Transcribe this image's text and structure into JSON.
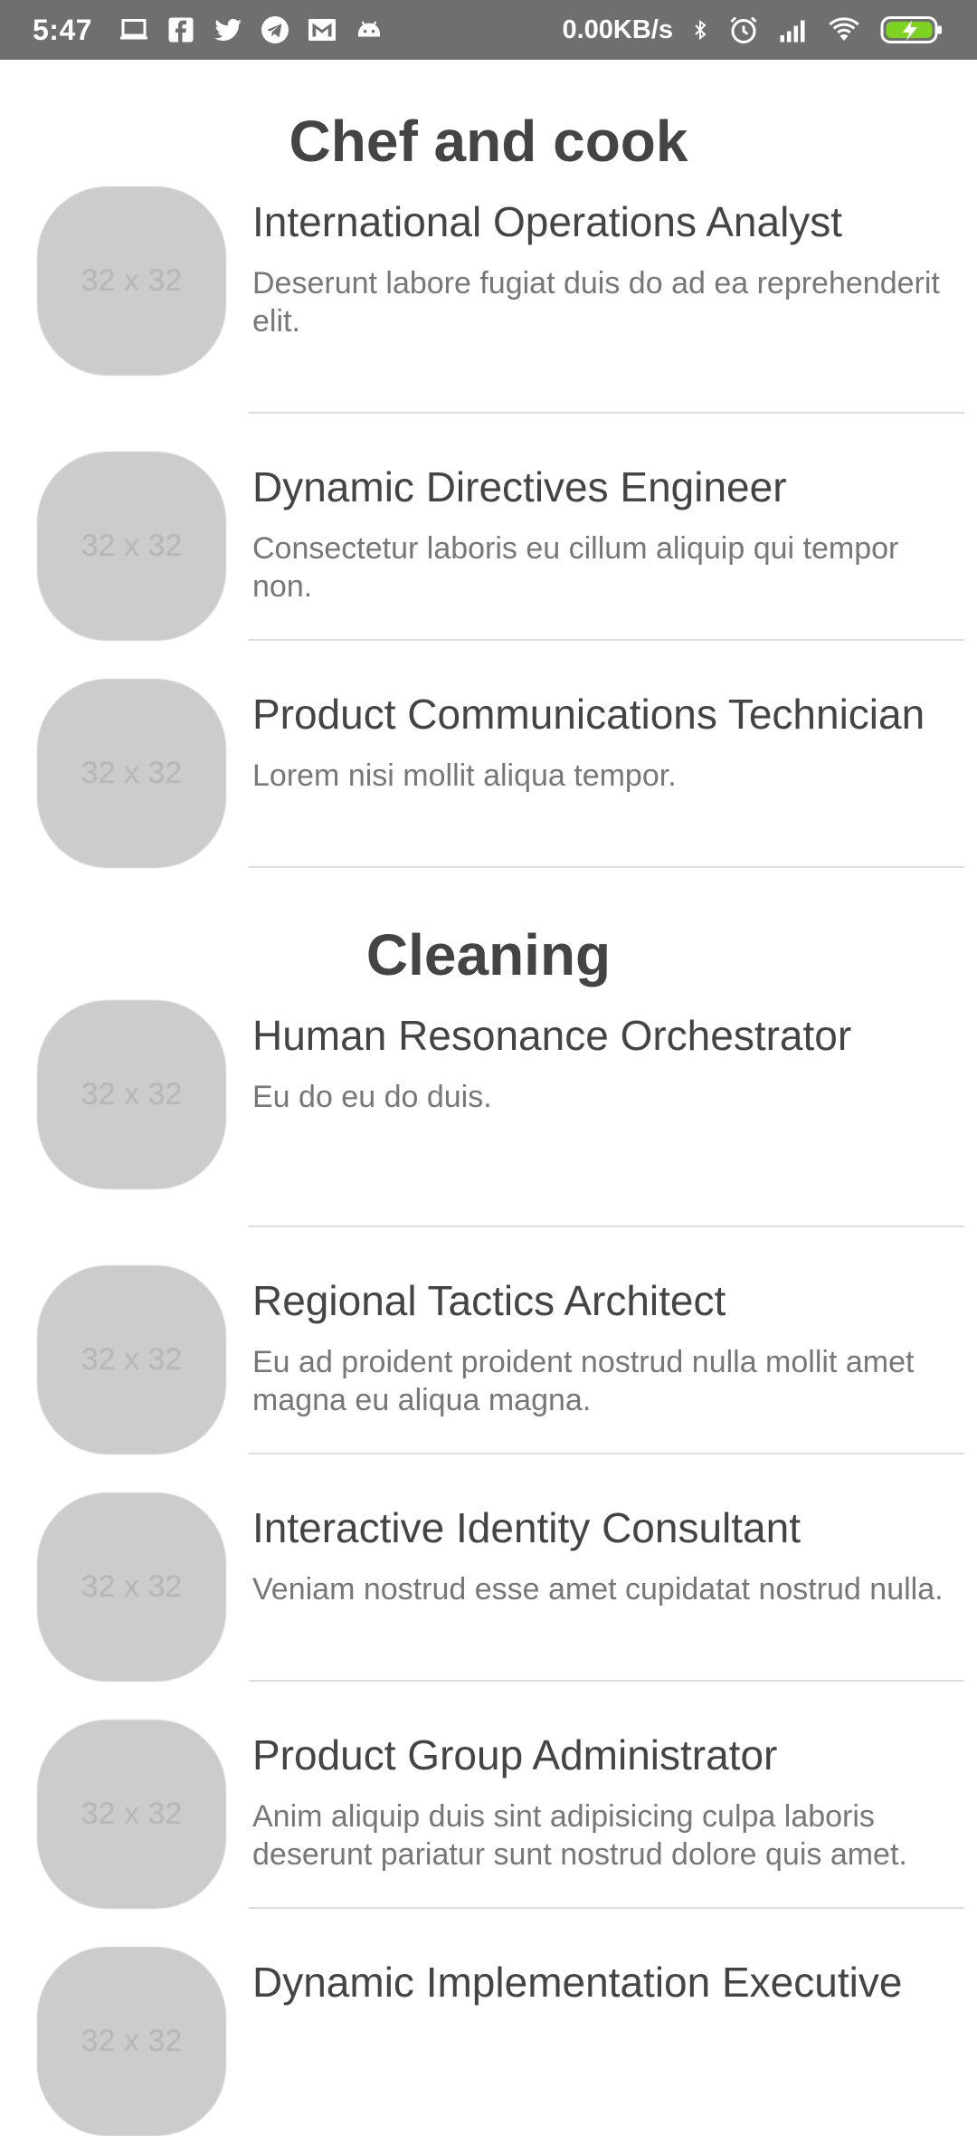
{
  "status_bar": {
    "time": "5:47",
    "speed": "0.00KB/s",
    "left_icons": [
      "laptop-icon",
      "facebook-icon",
      "twitter-icon",
      "telegram-icon",
      "gmail-icon",
      "android-icon"
    ],
    "right_icons": [
      "bluetooth-icon",
      "alarm-icon",
      "signal-icon",
      "wifi-icon",
      "battery-charging-icon"
    ],
    "background_color": "#6f6f6f",
    "battery_color": "#7ed321"
  },
  "avatar_placeholder": "32 x 32",
  "sections": [
    {
      "title": "Chef and cook",
      "items": [
        {
          "title": "International Operations Analyst",
          "description": "Deserunt labore fugiat duis do ad ea reprehenderit elit."
        },
        {
          "title": "Dynamic Directives Engineer",
          "description": "Consectetur laboris eu cillum aliquip qui tempor non."
        },
        {
          "title": "Product Communications Technician",
          "description": "Lorem nisi mollit aliqua tempor."
        }
      ]
    },
    {
      "title": "Cleaning",
      "items": [
        {
          "title": "Human Resonance Orchestrator",
          "description": "Eu do eu do duis."
        },
        {
          "title": "Regional Tactics Architect",
          "description": "Eu ad proident proident nostrud nulla mollit amet magna eu aliqua magna."
        },
        {
          "title": "Interactive Identity Consultant",
          "description": "Veniam nostrud esse amet cupidatat nostrud nulla."
        },
        {
          "title": "Product Group Administrator",
          "description": "Anim aliquip duis sint adipisicing culpa laboris deserunt pariatur sunt nostrud dolore quis amet."
        },
        {
          "title": "Dynamic Implementation Executive",
          "description": ""
        }
      ]
    }
  ]
}
